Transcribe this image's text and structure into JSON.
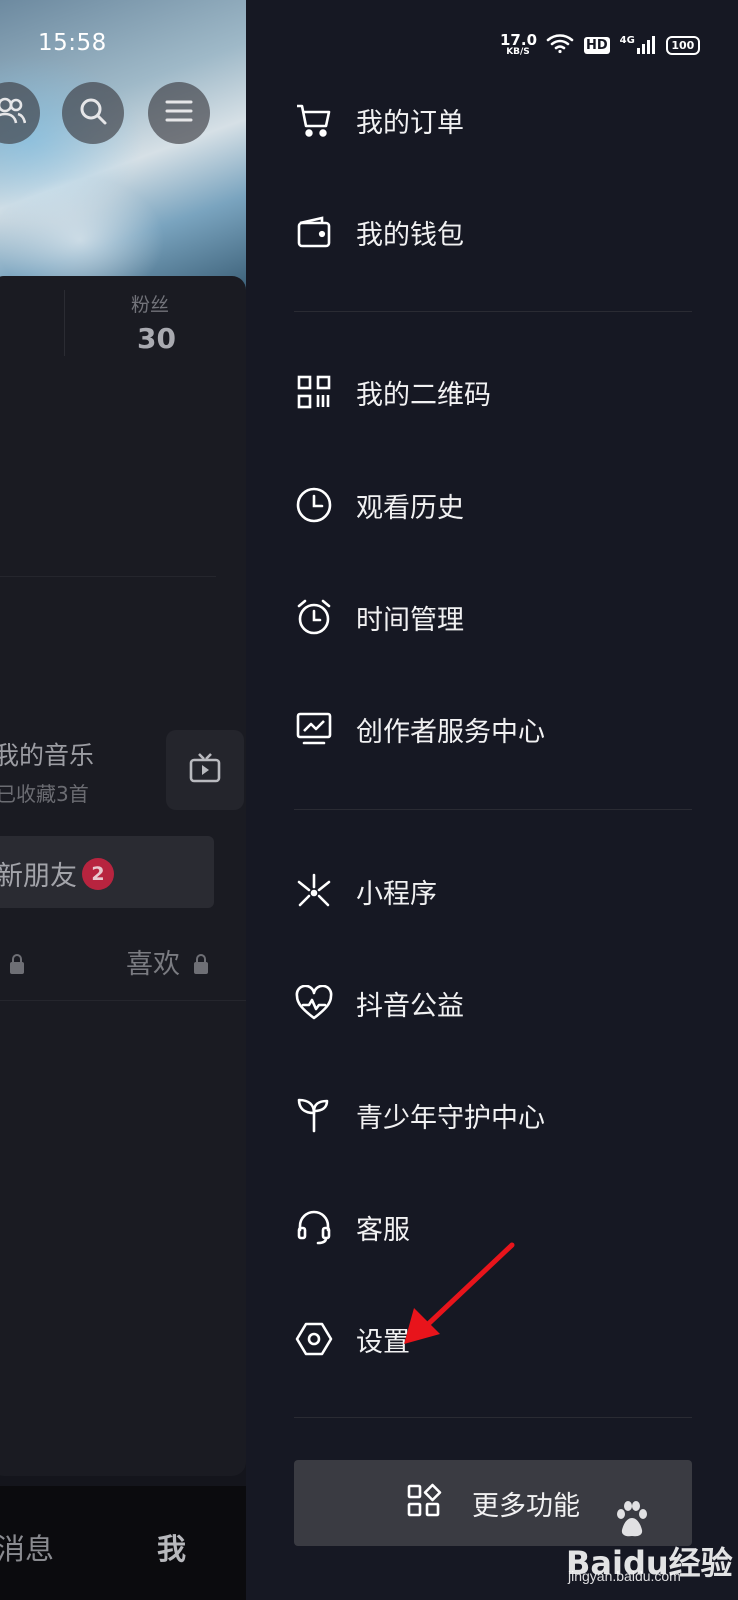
{
  "status_bar": {
    "time": "15:58",
    "net_speed": "17.0",
    "net_unit": "KB/S",
    "hd": "HD",
    "network": "4G",
    "battery": "100"
  },
  "profile_bg": {
    "fans_label": "粉丝",
    "fans_value": "30",
    "music_title": "我的音乐",
    "music_sub": "已收藏3首",
    "friends_label": "新朋友",
    "friends_badge": "2",
    "likes_tab": "喜欢",
    "nav_messages": "消息",
    "nav_me": "我"
  },
  "drawer": {
    "items": [
      {
        "label": "我的订单",
        "icon": "cart-icon"
      },
      {
        "label": "我的钱包",
        "icon": "wallet-icon"
      },
      {
        "label": "我的二维码",
        "icon": "qrcode-icon"
      },
      {
        "label": "观看历史",
        "icon": "clock-icon"
      },
      {
        "label": "时间管理",
        "icon": "alarm-icon"
      },
      {
        "label": "创作者服务中心",
        "icon": "monitor-chart-icon"
      },
      {
        "label": "小程序",
        "icon": "mini-program-icon"
      },
      {
        "label": "抖音公益",
        "icon": "heart-charity-icon"
      },
      {
        "label": "青少年守护中心",
        "icon": "sprout-icon"
      },
      {
        "label": "客服",
        "icon": "headset-icon"
      },
      {
        "label": "设置",
        "icon": "hexagon-settings-icon"
      }
    ],
    "more_label": "更多功能",
    "accent_color": "#e8141b"
  },
  "watermark": {
    "brand": "Baidu经验",
    "url": "jingyan.baidu.com"
  }
}
